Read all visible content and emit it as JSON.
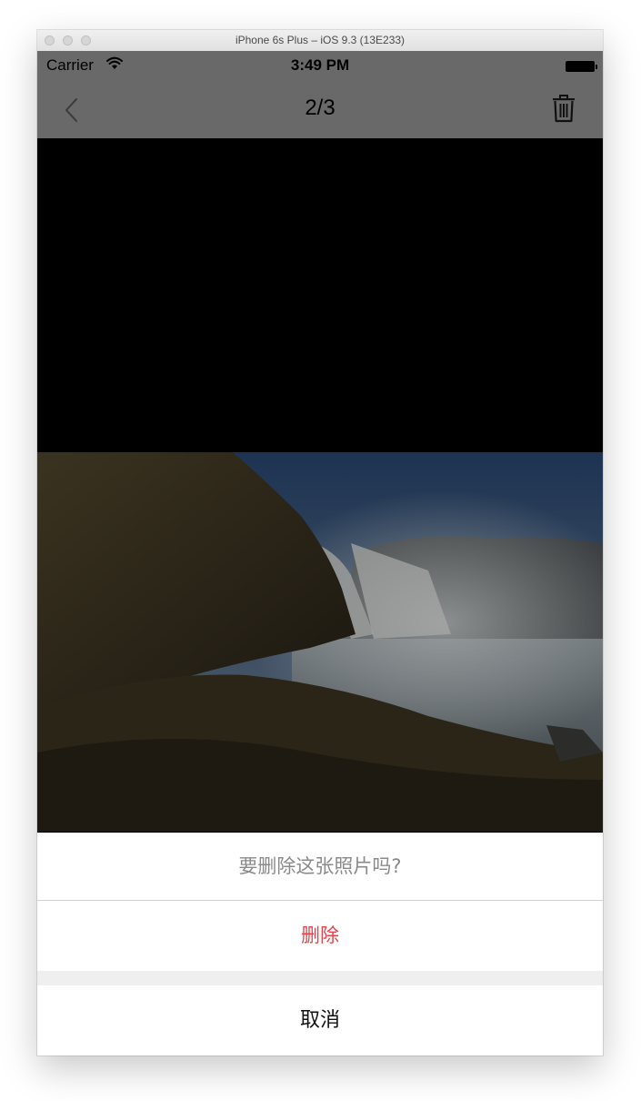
{
  "window": {
    "title": "iPhone 6s Plus – iOS 9.3 (13E233)"
  },
  "status_bar": {
    "carrier": "Carrier",
    "time": "3:49 PM",
    "wifi_icon": "wifi-icon",
    "battery_icon": "battery-icon"
  },
  "nav_bar": {
    "title": "2/3",
    "back_icon": "chevron-left-icon",
    "delete_icon": "trash-icon"
  },
  "action_sheet": {
    "message": "要删除这张照片吗?",
    "delete_label": "删除",
    "cancel_label": "取消"
  },
  "colors": {
    "destructive": "#e6434b",
    "nav_background": "#696969"
  }
}
